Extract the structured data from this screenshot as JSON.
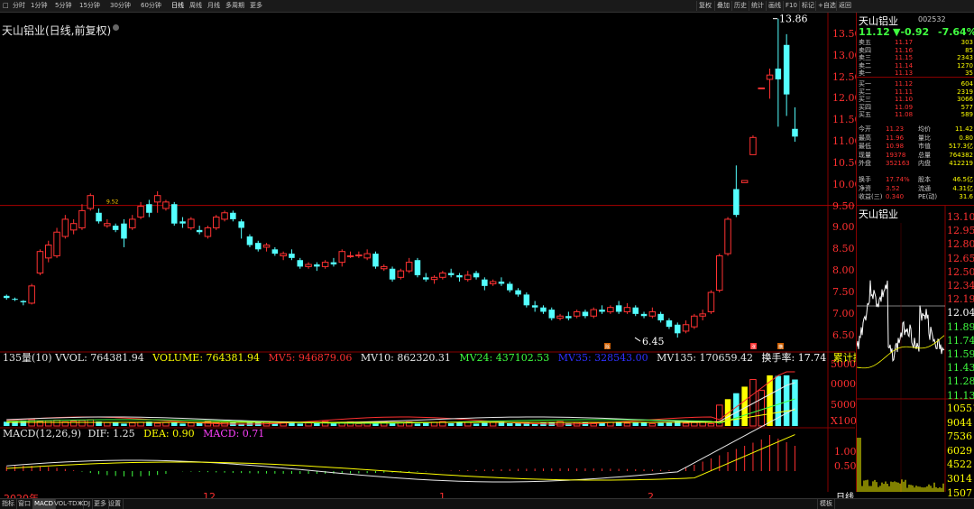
{
  "topbar": {
    "left_icon": "□",
    "periods": [
      "分时",
      "1分钟",
      "5分钟",
      "15分钟",
      "30分钟",
      "60分钟",
      "日线",
      "周线",
      "月线",
      "多周期",
      "更多"
    ],
    "active_period": "日线",
    "right_buttons": [
      "复权",
      "叠加",
      "历史",
      "统计",
      "画线",
      "F10",
      "标记",
      "+自选",
      "返回"
    ]
  },
  "chart": {
    "title": "天山铝业(日线,前复权)",
    "price_axis": [
      "13.50",
      "13.00",
      "12.50",
      "12.00",
      "11.50",
      "11.00",
      "10.50",
      "10.00",
      "9.50",
      "9.00",
      "8.50",
      "8.00",
      "7.50",
      "7.00",
      "6.50"
    ],
    "high_label": "13.86",
    "low_label": "6.45",
    "ref_label": "9.52",
    "vol_axis": [
      "5000",
      "0000",
      "5000",
      "X100"
    ],
    "macd_axis": [
      "1.00",
      "0.50"
    ],
    "x_labels": [
      "2020年",
      "12",
      "1",
      "2"
    ],
    "bottom_label": "日线",
    "icons": [
      "除",
      "涨",
      "横"
    ]
  },
  "chart_data": {
    "type": "candlestick",
    "title": "天山铝业(日线,前复权)",
    "y_range": [
      6.2,
      14.0
    ],
    "candles": [
      {
        "o": 7.42,
        "c": 7.37,
        "h": 7.45,
        "l": 7.33
      },
      {
        "o": 7.35,
        "c": 7.33,
        "h": 7.38,
        "l": 7.3
      },
      {
        "o": 7.3,
        "c": 7.27,
        "h": 7.32,
        "l": 7.2
      },
      {
        "o": 7.25,
        "c": 7.65,
        "h": 7.7,
        "l": 7.22
      },
      {
        "o": 7.95,
        "c": 8.45,
        "h": 8.5,
        "l": 7.9
      },
      {
        "o": 8.3,
        "c": 8.6,
        "h": 8.7,
        "l": 8.2
      },
      {
        "o": 8.35,
        "c": 8.9,
        "h": 9.0,
        "l": 8.3
      },
      {
        "o": 8.8,
        "c": 9.2,
        "h": 9.3,
        "l": 8.75
      },
      {
        "o": 8.95,
        "c": 9.1,
        "h": 9.2,
        "l": 8.85
      },
      {
        "o": 9.0,
        "c": 9.4,
        "h": 9.55,
        "l": 8.95
      },
      {
        "o": 9.45,
        "c": 9.75,
        "h": 9.8,
        "l": 9.4
      },
      {
        "o": 9.35,
        "c": 9.15,
        "h": 9.45,
        "l": 9.1
      },
      {
        "o": 9.05,
        "c": 9.1,
        "h": 9.2,
        "l": 9.0
      },
      {
        "o": 9.05,
        "c": 8.95,
        "h": 9.1,
        "l": 8.9
      },
      {
        "o": 9.1,
        "c": 8.75,
        "h": 9.2,
        "l": 8.55
      },
      {
        "o": 9.0,
        "c": 9.2,
        "h": 9.3,
        "l": 8.95
      },
      {
        "o": 9.25,
        "c": 9.5,
        "h": 9.6,
        "l": 9.2
      },
      {
        "o": 9.55,
        "c": 9.35,
        "h": 9.65,
        "l": 9.25
      },
      {
        "o": 9.6,
        "c": 9.75,
        "h": 9.85,
        "l": 9.35
      },
      {
        "o": 9.45,
        "c": 9.6,
        "h": 9.65,
        "l": 9.4
      },
      {
        "o": 9.55,
        "c": 9.1,
        "h": 9.6,
        "l": 9.05
      },
      {
        "o": 9.15,
        "c": 9.1,
        "h": 9.25,
        "l": 9.0
      },
      {
        "o": 9.0,
        "c": 9.2,
        "h": 9.25,
        "l": 8.95
      },
      {
        "o": 8.95,
        "c": 8.9,
        "h": 9.05,
        "l": 8.85
      },
      {
        "o": 8.8,
        "c": 9.0,
        "h": 9.05,
        "l": 8.75
      },
      {
        "o": 9.0,
        "c": 9.25,
        "h": 9.3,
        "l": 8.95
      },
      {
        "o": 9.2,
        "c": 9.35,
        "h": 9.4,
        "l": 9.15
      },
      {
        "o": 9.35,
        "c": 9.2,
        "h": 9.4,
        "l": 9.15
      },
      {
        "o": 9.15,
        "c": 9.0,
        "h": 9.2,
        "l": 8.75
      },
      {
        "o": 8.8,
        "c": 8.6,
        "h": 8.85,
        "l": 8.55
      },
      {
        "o": 8.65,
        "c": 8.5,
        "h": 8.7,
        "l": 8.45
      },
      {
        "o": 8.55,
        "c": 8.6,
        "h": 8.65,
        "l": 8.45
      },
      {
        "o": 8.5,
        "c": 8.4,
        "h": 8.55,
        "l": 8.35
      },
      {
        "o": 8.35,
        "c": 8.4,
        "h": 8.45,
        "l": 8.25
      },
      {
        "o": 8.4,
        "c": 8.3,
        "h": 8.5,
        "l": 8.25
      },
      {
        "o": 8.25,
        "c": 8.1,
        "h": 8.3,
        "l": 8.05
      },
      {
        "o": 8.1,
        "c": 8.15,
        "h": 8.2,
        "l": 8.05
      },
      {
        "o": 8.15,
        "c": 8.1,
        "h": 8.2,
        "l": 8.0
      },
      {
        "o": 8.1,
        "c": 8.2,
        "h": 8.25,
        "l": 8.05
      },
      {
        "o": 8.2,
        "c": 8.15,
        "h": 8.3,
        "l": 8.1
      },
      {
        "o": 8.2,
        "c": 8.45,
        "h": 8.5,
        "l": 8.1
      },
      {
        "o": 8.35,
        "c": 8.35,
        "h": 8.45,
        "l": 8.3
      },
      {
        "o": 8.35,
        "c": 8.37,
        "h": 8.45,
        "l": 8.3
      },
      {
        "o": 8.3,
        "c": 8.4,
        "h": 8.5,
        "l": 8.25
      },
      {
        "o": 8.4,
        "c": 8.1,
        "h": 8.45,
        "l": 8.05
      },
      {
        "o": 8.05,
        "c": 8.1,
        "h": 8.15,
        "l": 8.0
      },
      {
        "o": 8.05,
        "c": 7.8,
        "h": 8.1,
        "l": 7.75
      },
      {
        "o": 7.85,
        "c": 8.0,
        "h": 8.05,
        "l": 7.8
      },
      {
        "o": 8.0,
        "c": 8.2,
        "h": 8.3,
        "l": 7.95
      },
      {
        "o": 8.25,
        "c": 7.9,
        "h": 8.3,
        "l": 7.85
      },
      {
        "o": 7.85,
        "c": 7.8,
        "h": 7.95,
        "l": 7.75
      },
      {
        "o": 7.8,
        "c": 7.85,
        "h": 7.9,
        "l": 7.7
      },
      {
        "o": 7.85,
        "c": 7.95,
        "h": 8.0,
        "l": 7.8
      },
      {
        "o": 7.95,
        "c": 7.9,
        "h": 8.05,
        "l": 7.85
      },
      {
        "o": 7.9,
        "c": 7.85,
        "h": 7.95,
        "l": 7.75
      },
      {
        "o": 7.8,
        "c": 7.9,
        "h": 8.0,
        "l": 7.75
      },
      {
        "o": 7.95,
        "c": 7.85,
        "h": 8.0,
        "l": 7.8
      },
      {
        "o": 7.8,
        "c": 7.65,
        "h": 7.85,
        "l": 7.55
      },
      {
        "o": 7.7,
        "c": 7.75,
        "h": 7.8,
        "l": 7.65
      },
      {
        "o": 7.75,
        "c": 7.7,
        "h": 7.85,
        "l": 7.65
      },
      {
        "o": 7.7,
        "c": 7.55,
        "h": 7.75,
        "l": 7.5
      },
      {
        "o": 7.55,
        "c": 7.45,
        "h": 7.6,
        "l": 7.4
      },
      {
        "o": 7.45,
        "c": 7.2,
        "h": 7.5,
        "l": 7.15
      },
      {
        "o": 7.2,
        "c": 7.15,
        "h": 7.3,
        "l": 7.05
      },
      {
        "o": 7.15,
        "c": 7.05,
        "h": 7.2,
        "l": 7.0
      },
      {
        "o": 7.1,
        "c": 6.9,
        "h": 7.15,
        "l": 6.85
      },
      {
        "o": 6.9,
        "c": 6.95,
        "h": 7.0,
        "l": 6.85
      },
      {
        "o": 6.95,
        "c": 6.9,
        "h": 7.05,
        "l": 6.85
      },
      {
        "o": 6.95,
        "c": 7.05,
        "h": 7.1,
        "l": 6.9
      },
      {
        "o": 7.05,
        "c": 6.95,
        "h": 7.1,
        "l": 6.9
      },
      {
        "o": 6.95,
        "c": 7.1,
        "h": 7.15,
        "l": 6.9
      },
      {
        "o": 7.1,
        "c": 7.05,
        "h": 7.2,
        "l": 7.0
      },
      {
        "o": 7.05,
        "c": 7.15,
        "h": 7.2,
        "l": 7.0
      },
      {
        "o": 7.2,
        "c": 7.05,
        "h": 7.3,
        "l": 7.0
      },
      {
        "o": 7.05,
        "c": 7.15,
        "h": 7.25,
        "l": 7.0
      },
      {
        "o": 7.15,
        "c": 7.0,
        "h": 7.2,
        "l": 6.95
      },
      {
        "o": 7.0,
        "c": 6.95,
        "h": 7.05,
        "l": 6.9
      },
      {
        "o": 6.95,
        "c": 7.05,
        "h": 7.15,
        "l": 6.9
      },
      {
        "o": 7.0,
        "c": 6.85,
        "h": 7.05,
        "l": 6.8
      },
      {
        "o": 6.85,
        "c": 6.7,
        "h": 6.9,
        "l": 6.65
      },
      {
        "o": 6.75,
        "c": 6.55,
        "h": 6.8,
        "l": 6.45
      },
      {
        "o": 6.6,
        "c": 6.75,
        "h": 6.85,
        "l": 6.55
      },
      {
        "o": 6.7,
        "c": 6.95,
        "h": 7.0,
        "l": 6.65
      },
      {
        "o": 6.95,
        "c": 7.0,
        "h": 7.1,
        "l": 6.85
      },
      {
        "o": 7.05,
        "c": 7.5,
        "h": 7.55,
        "l": 7.0
      },
      {
        "o": 7.55,
        "c": 8.35,
        "h": 8.4,
        "l": 7.5
      },
      {
        "o": 8.4,
        "c": 9.2,
        "h": 9.25,
        "l": 8.35
      },
      {
        "o": 9.9,
        "c": 9.3,
        "h": 10.45,
        "l": 9.25
      },
      {
        "o": 10.05,
        "c": 10.1,
        "h": 10.1,
        "l": 10.05
      },
      {
        "o": 10.7,
        "c": 11.1,
        "h": 11.15,
        "l": 10.7
      },
      {
        "o": 12.25,
        "c": 12.25,
        "h": 12.25,
        "l": 12.25
      },
      {
        "o": 12.45,
        "c": 12.55,
        "h": 12.7,
        "l": 12.0
      },
      {
        "o": 12.7,
        "c": 12.45,
        "h": 13.86,
        "l": 11.35
      },
      {
        "o": 13.25,
        "c": 12.1,
        "h": 13.5,
        "l": 11.6
      },
      {
        "o": 11.3,
        "c": 11.12,
        "h": 11.8,
        "l": 11.0
      }
    ],
    "ma_label": "MV5: 946879.06",
    "volume": {
      "title": "135量(10)",
      "VVOL": "764381.94",
      "VOLUME": "764381.94",
      "MV5": "946879.06",
      "MV10": "862320.31",
      "MV24": "437102.53",
      "MV35": "328543.00",
      "MV135": "170659.42",
      "turnover_rate": "17.74",
      "cum_turnover": ""
    },
    "macd": {
      "params": "MACD(12,26,9)",
      "DIF": "1.25",
      "DEA": "0.90",
      "MACD": "0.71"
    }
  },
  "indicators": {
    "vol_line": "135量(10) VVOL: 764381.94",
    "vol_volume": "VOLUME: 764381.94",
    "vol_mv5": "MV5: 946879.06",
    "vol_mv10": "MV10: 862320.31",
    "vol_mv24": "MV24: 437102.53",
    "vol_mv35": "MV35: 328543.00",
    "vol_mv135": "MV135: 170659.42",
    "vol_turn": "换手率: 17.74",
    "vol_cum": "累计换手:",
    "macd_params": "MACD(12,26,9)",
    "macd_dif": "DIF: 1.25",
    "macd_dea": "DEA: 0.90",
    "macd_macd": "MACD: 0.71"
  },
  "quote": {
    "name": "天山铝业",
    "code": "002532",
    "price": "11.12",
    "change": "▼-0.92",
    "pct": "-7.64%",
    "asks": [
      {
        "label": "卖五",
        "price": "11.17",
        "vol": "303"
      },
      {
        "label": "卖四",
        "price": "11.16",
        "vol": "85"
      },
      {
        "label": "卖三",
        "price": "11.15",
        "vol": "2343"
      },
      {
        "label": "卖二",
        "price": "11.14",
        "vol": "1270"
      },
      {
        "label": "卖一",
        "price": "11.13",
        "vol": "35"
      }
    ],
    "bids": [
      {
        "label": "买一",
        "price": "11.12",
        "vol": "604"
      },
      {
        "label": "买二",
        "price": "11.11",
        "vol": "2319"
      },
      {
        "label": "买三",
        "price": "11.10",
        "vol": "3066"
      },
      {
        "label": "买四",
        "price": "11.09",
        "vol": "577"
      },
      {
        "label": "买五",
        "price": "11.08",
        "vol": "589"
      }
    ],
    "stats": [
      {
        "l1": "今开",
        "v1": "11.23",
        "l2": "均价",
        "v2": "11.42"
      },
      {
        "l1": "最高",
        "v1": "11.96",
        "l2": "量比",
        "v2": "0.80"
      },
      {
        "l1": "最低",
        "v1": "10.98",
        "l2": "市值",
        "v2": "517.3亿"
      },
      {
        "l1": "现量",
        "v1": "19378",
        "l2": "总量",
        "v2": "764382"
      },
      {
        "l1": "外盘",
        "v1": "352163",
        "l2": "内盘",
        "v2": "412219"
      }
    ],
    "stats2": [
      {
        "l1": "换手",
        "v1": "17.74%",
        "l2": "股本",
        "v2": "46.5亿"
      },
      {
        "l1": "净资",
        "v1": "3.52",
        "l2": "流通",
        "v2": "4.31亿"
      },
      {
        "l1": "收益(三)",
        "v1": "0.340",
        "l2": "PE(动)",
        "v2": "31.6"
      }
    ]
  },
  "mini": {
    "name": "天山铝业",
    "price_labels": [
      "13.10",
      "12.95",
      "12.80",
      "12.65",
      "12.50",
      "12.34",
      "12.19",
      "12.04",
      "11.89",
      "11.74",
      "11.59",
      "11.43",
      "11.28",
      "11.13"
    ],
    "vol_labels": [
      "10551",
      "9044",
      "7536",
      "6029",
      "4522",
      "3014",
      "1507"
    ]
  },
  "bottombar": {
    "items": [
      "指标",
      "窗口",
      "MACD",
      "VOL-TDX",
      "KDJ",
      "更多",
      "设置"
    ],
    "active": "MACD",
    "right_item": "模板"
  }
}
